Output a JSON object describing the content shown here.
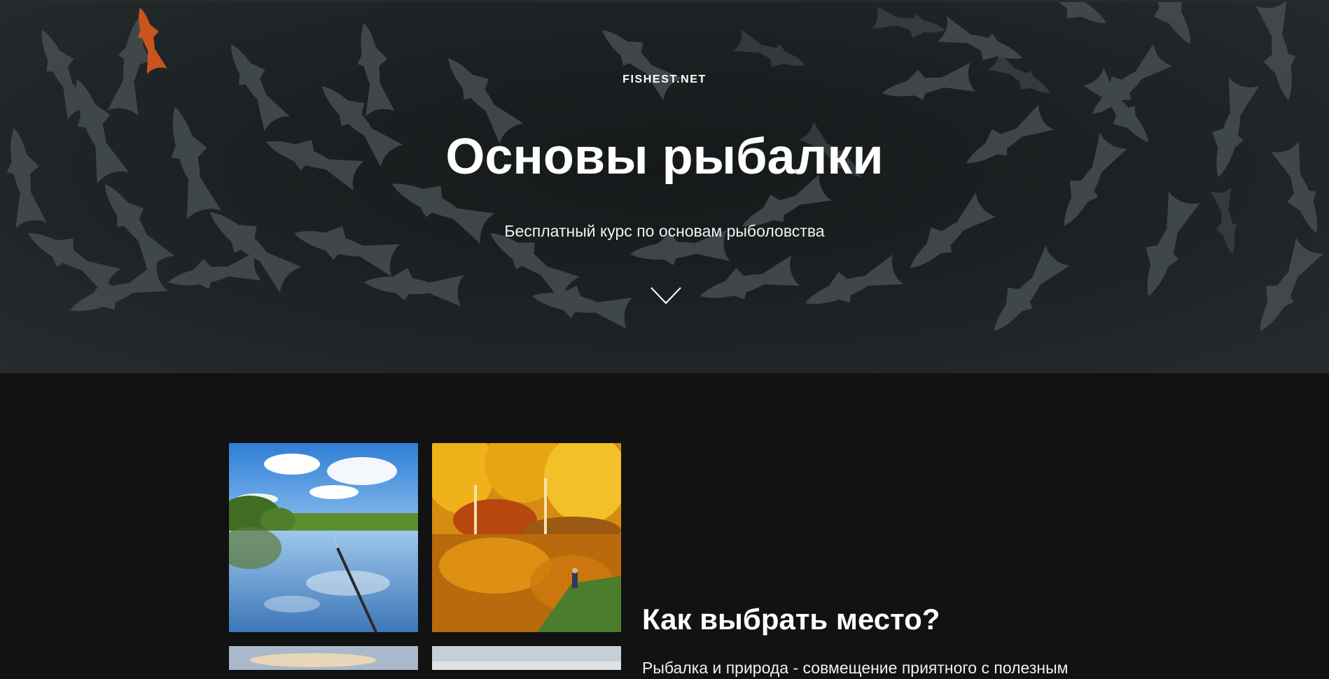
{
  "hero": {
    "site_name": "FISHEST.NET",
    "title": "Основы рыбалки",
    "subtitle": "Бесплатный курс по основам рыболовства",
    "scroll_icon": "chevron-down-icon"
  },
  "section": {
    "title": "Как выбрать место?",
    "text": "Рыбалка и природа - совмещение приятного с полезным"
  },
  "colors": {
    "page_background": "#121212",
    "hero_background": "#1d2224",
    "fish": "#4a5153",
    "koi": "#c8551f",
    "text": "#ffffff"
  }
}
